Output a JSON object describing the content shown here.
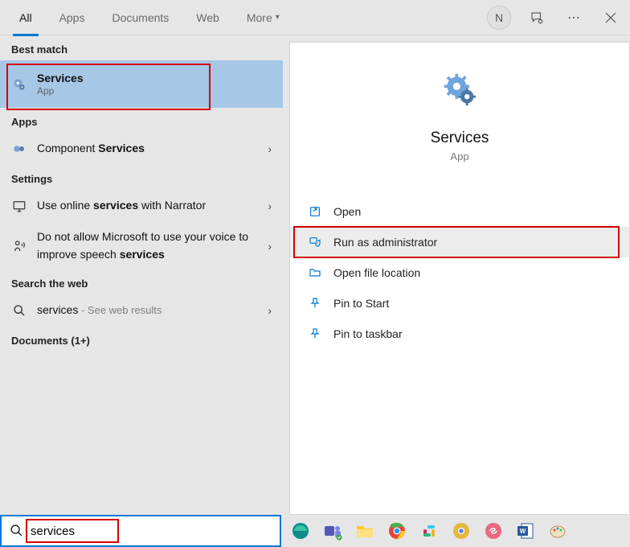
{
  "tabs": {
    "items": [
      "All",
      "Apps",
      "Documents",
      "Web",
      "More"
    ],
    "activeIndex": 0
  },
  "user": {
    "initial": "N"
  },
  "left": {
    "bestMatchHeader": "Best match",
    "bestMatch": {
      "title": "Services",
      "sub": "App"
    },
    "appsHeader": "Apps",
    "apps": [
      {
        "prefix": "Component ",
        "bold": "Services"
      }
    ],
    "settingsHeader": "Settings",
    "settings": [
      {
        "pre": "Use online ",
        "bold": "services",
        "post": " with Narrator"
      },
      {
        "pre": "Do not allow Microsoft to use your voice to improve speech ",
        "bold": "services",
        "post": ""
      }
    ],
    "searchWebHeader": "Search the web",
    "webResult": {
      "term": "services",
      "suffix": " - See web results"
    },
    "documentsHeader": "Documents (1+)"
  },
  "details": {
    "title": "Services",
    "sub": "App",
    "actions": {
      "open": "Open",
      "runAdmin": "Run as administrator",
      "openLoc": "Open file location",
      "pinStart": "Pin to Start",
      "pinTaskbar": "Pin to taskbar"
    }
  },
  "search": {
    "value": "services"
  }
}
